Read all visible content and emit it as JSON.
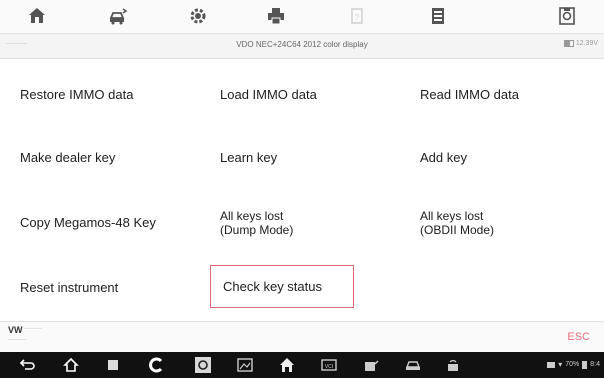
{
  "toolbar": {
    "icons": [
      "home-icon",
      "vehicle-swap-icon",
      "settings-icon",
      "print-icon",
      "help-icon",
      "save-icon",
      "data-logging-icon"
    ]
  },
  "subheader": {
    "left": "———",
    "title": "VDO NEC+24C64 2012 color display",
    "battery": "12.39V"
  },
  "functions": {
    "restore_immo": "Restore IMMO data",
    "load_immo": "Load IMMO data",
    "read_immo": "Read IMMO data",
    "make_dealer_key": "Make dealer key",
    "learn_key": "Learn key",
    "add_key": "Add key",
    "copy_megamos": "Copy Megamos-48 Key",
    "all_keys_dump_l1": "All keys lost",
    "all_keys_dump_l2": "(Dump Mode)",
    "all_keys_obd_l1": "All keys lost",
    "all_keys_obd_l2": "(OBDII Mode)",
    "reset_instrument": "Reset instrument",
    "check_key_status": "Check key status"
  },
  "selected": "check_key_status",
  "vehicle_bar": {
    "make": "VW",
    "desc": "———",
    "sub": "———",
    "esc_label": "ESC"
  },
  "navbar": {
    "icons": [
      "back-icon",
      "home-icon",
      "recent-apps-icon",
      "chrome-icon",
      "camera-icon",
      "screenshot-icon",
      "autel-home-icon",
      "vci-icon",
      "shop-icon",
      "car-icon",
      "remote-icon"
    ],
    "battery_pct": "70%",
    "time": "8:4"
  },
  "colors": {
    "accent": "#e06a7a",
    "esc": "#e8707e",
    "navbar": "#111111"
  }
}
